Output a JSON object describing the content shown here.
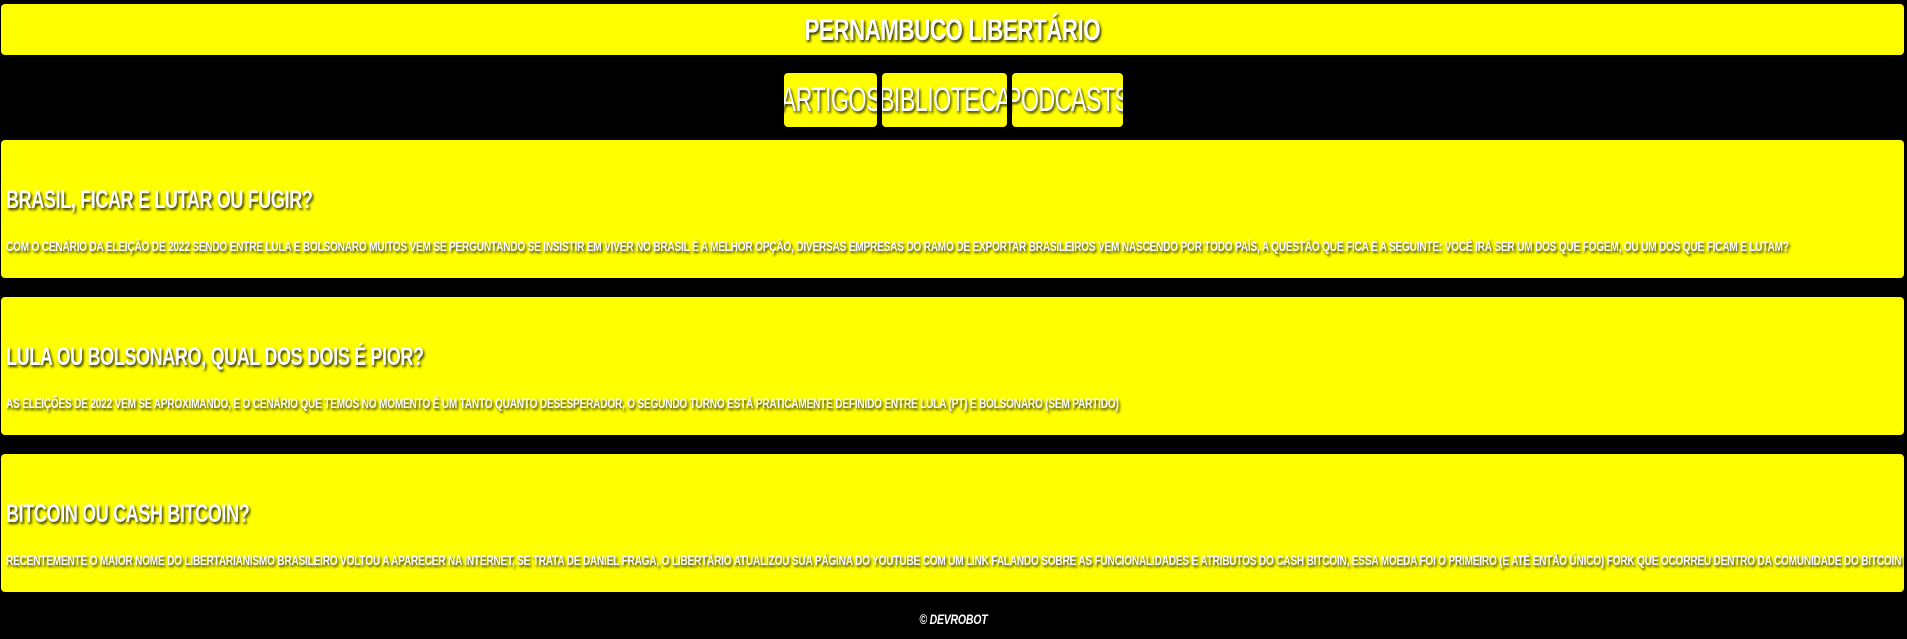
{
  "header": {
    "title": "Pernambuco Libertário"
  },
  "nav": {
    "items": [
      {
        "label": "Artigos"
      },
      {
        "label": "Biblioteca"
      },
      {
        "label": "Podcasts"
      }
    ]
  },
  "articles": [
    {
      "title": "Brasil, ficar e lutar ou fugir?",
      "summary": "Com o cenário da eleição de 2022 sendo entre Lula e Bolsonaro muitos vem se perguntando se insistir em viver no Brasil é a melhor opção, diversas empresas do ramo de exportar brasileiros vem nascendo por todo país, a questão que fica é a seguinte: você irá ser um dos que fogem, ou um dos que ficam e lutam?"
    },
    {
      "title": "Lula ou Bolsonaro, qual dos dois é pior?",
      "summary": "As eleições de 2022 vem se aproximando, e o cenário que temos no momento é um tanto quanto desesperador, o segundo turno está praticamente definido entre Lula (PT) e Bolsonaro (Sem partido)"
    },
    {
      "title": "Bitcoin ou Cash Bitcoin?",
      "summary": "Recentemente o maior nome do libertarianismo brasileiro voltou a aparecer na internet, se trata de Daniel Fraga, o libertário atualizou sua página do youtube com um link falando sobre as funcionalidades e atributos do cash bitcoin, essa moeda foi o primeiro (e até então único) fork que ocorreu dentro da comunidade do bitcoin"
    }
  ],
  "footer": {
    "text": "© DevRobot"
  },
  "colors": {
    "accent": "#ffff00",
    "background": "#000000",
    "text": "#ffffff"
  }
}
